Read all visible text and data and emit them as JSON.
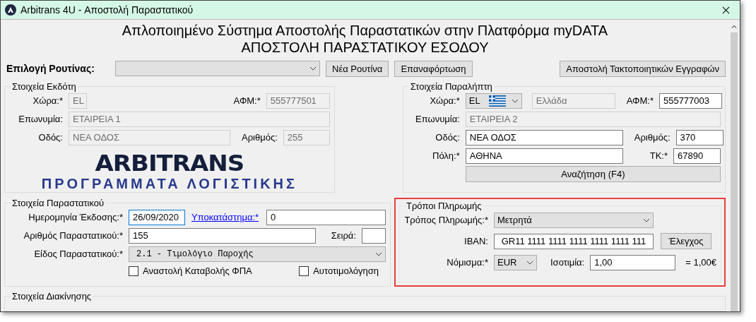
{
  "window": {
    "title": "Arbitrans 4U - Αποστολή Παραστατικού"
  },
  "header": [
    "Απλοποιημένο Σύστημα Αποστολής Παραστατικών στην Πλατφόρμα myDATA",
    "ΑΠΟΣΤΟΛΗ ΠΑΡΑΣΤΑΤΙΚΟΥ ΕΣΟΔΟΥ"
  ],
  "routine": {
    "label": "Επιλογή Ρουτίνας:"
  },
  "buttons": [
    "Νέα Ρουτίνα",
    "Επαναφόρτωση",
    "Αποστολή Τακτοποιητικών Εγγραφών"
  ],
  "issuer": {
    "title": "Στοιχεία Εκδότη",
    "country": {
      "label": "Χώρα:*",
      "value": "EL",
      "disabled": true
    },
    "vat": {
      "label": "ΑΦΜ:*",
      "value": "555777501",
      "disabled": true
    },
    "name": {
      "label": "Επωνυμία:",
      "value": "ΕΤΑΙΡΕΙΑ 1",
      "disabled": true
    },
    "street": {
      "label": "Οδός:",
      "value": "ΝΕΑ ΟΔΟΣ",
      "disabled": true
    },
    "number": {
      "label": "Αριθμός:",
      "value": "255",
      "disabled": true
    }
  },
  "logo": {
    "name": "ARBITRANS",
    "tagline": "ΠΡΟΓΡΑΜΜΑΤΑ ΛΟΓΙΣΤΙΚΗΣ"
  },
  "recipient": {
    "title": "Στοιχεία Παραλήπτη",
    "country": {
      "label": "Χώρα:*",
      "value": "EL"
    },
    "country_name": {
      "value": "Ελλάδα",
      "disabled": true
    },
    "vat": {
      "label": "ΑΦΜ:*",
      "value": "555777003",
      "disabled": false
    },
    "name": {
      "label": "Επωνυμία:",
      "value": "ΕΤΑΙΡΕΙΑ 2",
      "disabled": true
    },
    "street": {
      "label": "Οδός:",
      "value": "ΝΕΑ ΟΔΟΣ",
      "disabled": false
    },
    "number": {
      "label": "Αριθμός:",
      "value": "370",
      "disabled": false
    },
    "city": {
      "label": "Πόλη:*",
      "value": "ΑΘΗΝΑ",
      "disabled": false
    },
    "zip": {
      "label": "ΤΚ:*",
      "value": "67890",
      "disabled": false
    },
    "search_button": "Αναζήτηση (F4)"
  },
  "document": {
    "title": "Στοιχεία Παραστατικού",
    "date": {
      "label": "Ημερομηνία Έκδοσης:*",
      "value": "26/09/2020",
      "focused": true
    },
    "branch": {
      "label": "Υποκατάστημα:*",
      "value": "0"
    },
    "number": {
      "label": "Αριθμός Παραστατικού:*",
      "value": "155"
    },
    "series": {
      "label": "Σειρά:"
    },
    "type": {
      "label": "Είδος Παραστατικού:*",
      "value": "2.1 - Τιμολόγιο Παροχής"
    },
    "checkboxes": [
      {
        "label": "Αναστολή Καταβολής ΦΠΑ",
        "checked": false
      },
      {
        "label": "Αυτοτιμολόγηση",
        "checked": false
      }
    ]
  },
  "payment": {
    "title": "Τρόποι Πληρωμής",
    "highlighted": true,
    "method": {
      "label": "Τρόπος Πληρωμής:*",
      "value": "Μετρητά"
    },
    "iban": {
      "label": "IBAN:",
      "value": "GR11 1111 1111 1111 1111 1111 111"
    },
    "check_button": "Έλεγχος",
    "currency": {
      "label": "Νόμισμα:*",
      "value": "EUR"
    },
    "rate": {
      "label": "Ισοτιμία:",
      "value": "1,00"
    },
    "result": "= 1,00€"
  },
  "movement": {
    "title": "Στοιχεία Διακίνησης"
  }
}
